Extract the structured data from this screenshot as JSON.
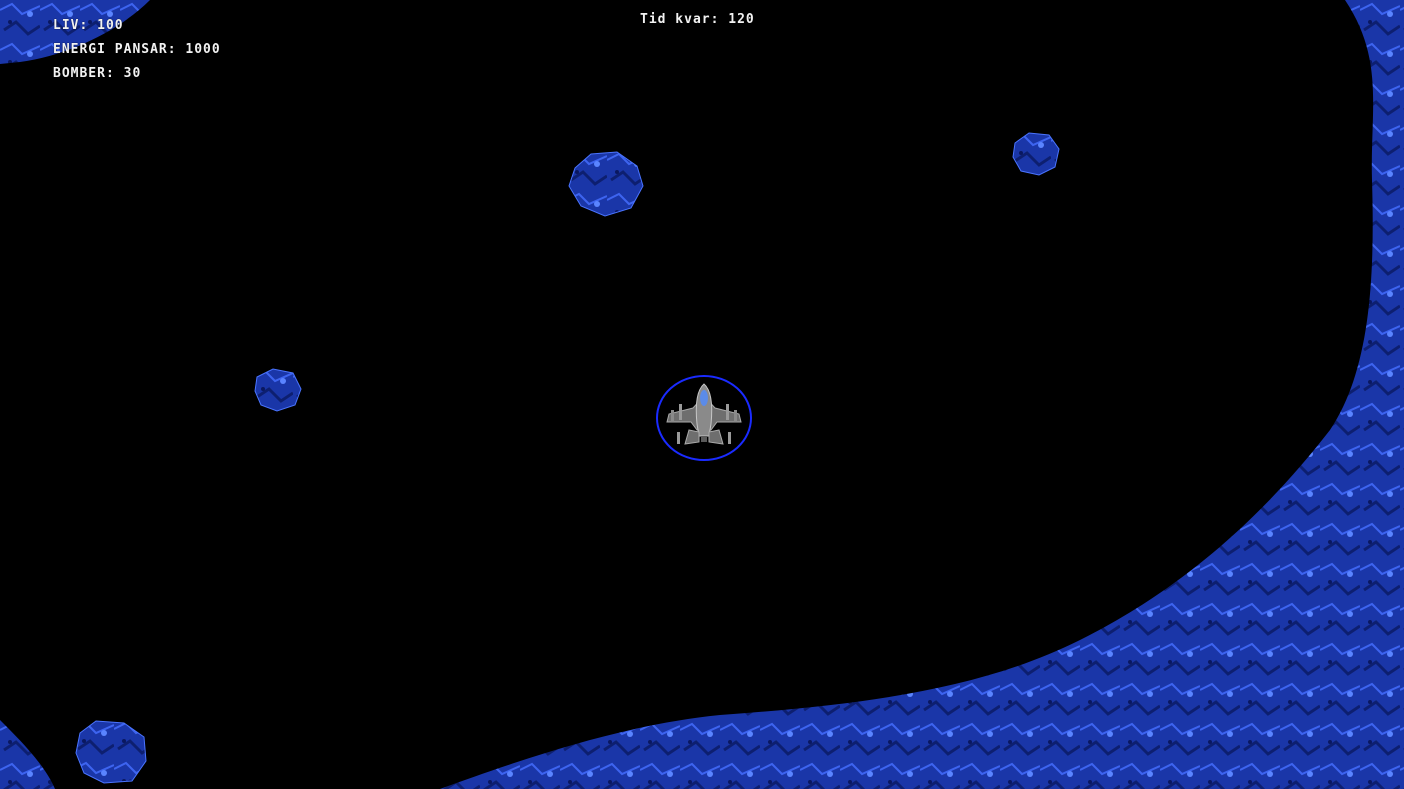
{
  "hud": {
    "lives_label": "LIV:",
    "lives_value": "100",
    "armor_label": "ENERGI PANSAR:",
    "armor_value": "1000",
    "bombs_label": "BOMBER:",
    "bombs_value": "30",
    "timer_label": "Tid kvar:",
    "timer_value": "120"
  },
  "colors": {
    "background": "#000000",
    "terrain": "#1e3fc0",
    "terrain_highlight": "#4a74ff",
    "hud_text": "#f2f2f2",
    "shield_ring": "#1a2bff"
  },
  "entities": {
    "player": {
      "icon": "spaceship-icon",
      "shield": "shield-ring"
    },
    "asteroid_count": 5
  }
}
